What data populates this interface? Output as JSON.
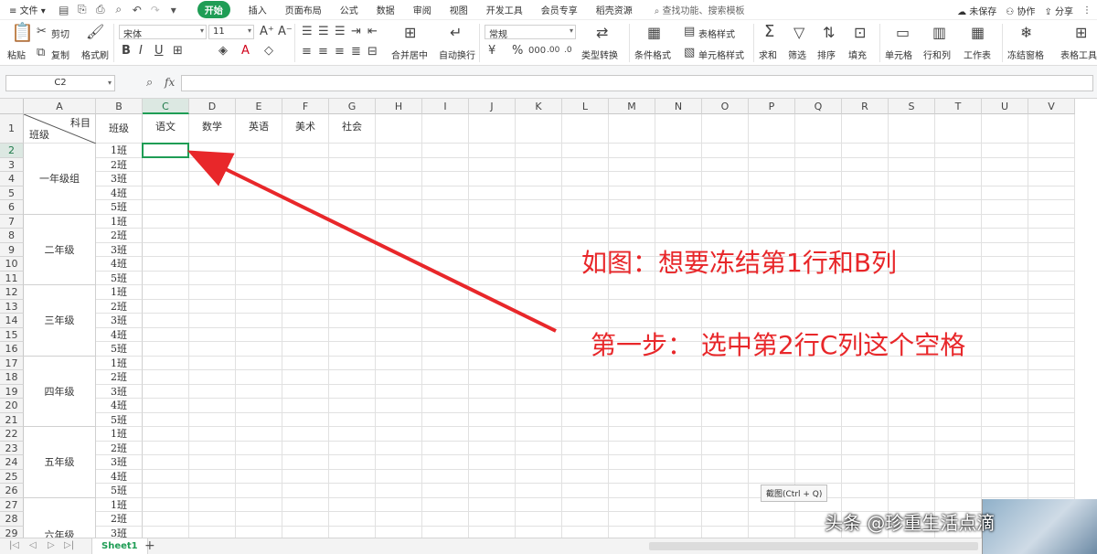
{
  "menu": {
    "file": "文件",
    "tabs": [
      "开始",
      "插入",
      "页面布局",
      "公式",
      "数据",
      "审阅",
      "视图",
      "开发工具",
      "会员专享",
      "稻壳资源"
    ],
    "active_tab": "开始",
    "search": "查找功能、搜索模板",
    "unsaved": "未保存",
    "collab": "协作",
    "share": "分享"
  },
  "ribbon": {
    "paste": "粘贴",
    "cut": "剪切",
    "copy": "复制",
    "format_painter": "格式刷",
    "font_name": "宋体",
    "font_size": "11",
    "number_format": "常规",
    "merge_center": "合并居中",
    "wrap": "自动换行",
    "type_convert": "类型转换",
    "conditional_format": "条件格式",
    "table_style": "表格样式",
    "cell_style": "单元格样式",
    "sum": "求和",
    "filter": "筛选",
    "sort": "排序",
    "fill": "填充",
    "cell": "单元格",
    "row_col": "行和列",
    "worksheet": "工作表",
    "freeze": "冻结窗格",
    "table_tools": "表格工具"
  },
  "formula": {
    "name_box": "C2",
    "fx": "fx",
    "value": ""
  },
  "sheet": {
    "columns": [
      "A",
      "B",
      "C",
      "D",
      "E",
      "F",
      "G",
      "H",
      "I",
      "J",
      "K",
      "L",
      "M",
      "N",
      "O",
      "P",
      "Q",
      "R",
      "S",
      "T",
      "U",
      "V"
    ],
    "header_row": {
      "a1_top": "科目",
      "a1_bottom": "班级",
      "b1": "班级",
      "subjects": [
        "语文",
        "数学",
        "英语",
        "美术",
        "社会"
      ]
    },
    "groups": [
      "一年级组",
      "二年级",
      "三年级",
      "四年级",
      "五年级",
      "六年级"
    ],
    "classes": [
      "1班",
      "2班",
      "3班",
      "4班",
      "5班"
    ],
    "selected_cell": "C2",
    "tab_name": "Sheet1",
    "add_sheet": "+"
  },
  "annotations": {
    "line1": "如图：想要冻结第1行和B列",
    "line2": "第一步：  选中第2行C列这个空格"
  },
  "tooltip": "截图(Ctrl + Q)",
  "watermark": "头条 @珍重生活点滴",
  "colors": {
    "accent": "#1f9d55",
    "annotation": "#e8272a"
  }
}
